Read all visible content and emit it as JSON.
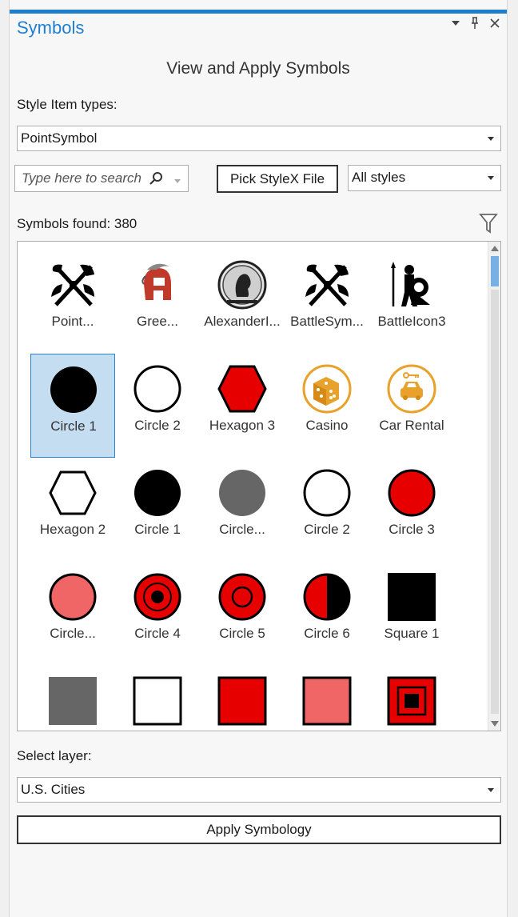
{
  "pane": {
    "title": "Symbols",
    "heading": "View and Apply Symbols"
  },
  "style_types": {
    "label": "Style Item types:",
    "value": "PointSymbol"
  },
  "search": {
    "placeholder": "Type here to search"
  },
  "pick_file_label": "Pick StyleX File",
  "styles_filter": {
    "value": "All styles"
  },
  "results": {
    "count_text": "Symbols found: 380"
  },
  "symbols": [
    {
      "label": "Point...",
      "icon": "battle-axe-icon"
    },
    {
      "label": "Gree...",
      "icon": "greek-helmet-icon"
    },
    {
      "label": "AlexanderI...",
      "icon": "alexander-coin-icon"
    },
    {
      "label": "BattleSym...",
      "icon": "battle-axe-icon"
    },
    {
      "label": "BattleIcon3",
      "icon": "warrior-icon"
    },
    {
      "label": "Circle 1",
      "icon": "circle-black-icon",
      "selected": true
    },
    {
      "label": "Circle 2",
      "icon": "circle-white-icon"
    },
    {
      "label": "Hexagon 3",
      "icon": "hexagon-red-icon"
    },
    {
      "label": "Casino",
      "icon": "casino-dice-icon"
    },
    {
      "label": "Car Rental",
      "icon": "car-rental-icon"
    },
    {
      "label": "Hexagon 2",
      "icon": "hexagon-white-icon"
    },
    {
      "label": "Circle 1",
      "icon": "circle-black-icon"
    },
    {
      "label": "Circle...",
      "icon": "circle-gray-icon"
    },
    {
      "label": "Circle 2",
      "icon": "circle-white-icon"
    },
    {
      "label": "Circle 3",
      "icon": "circle-red-icon"
    },
    {
      "label": "Circle...",
      "icon": "circle-pink-icon"
    },
    {
      "label": "Circle 4",
      "icon": "circle-bullseye-icon"
    },
    {
      "label": "Circle 5",
      "icon": "circle-ring-icon"
    },
    {
      "label": "Circle 6",
      "icon": "circle-half-icon"
    },
    {
      "label": "Square 1",
      "icon": "square-black-icon"
    },
    {
      "label": "",
      "icon": "square-gray-icon"
    },
    {
      "label": "",
      "icon": "square-white-icon"
    },
    {
      "label": "",
      "icon": "square-red-icon"
    },
    {
      "label": "",
      "icon": "square-pink-icon"
    },
    {
      "label": "",
      "icon": "square-nested-icon"
    }
  ],
  "layer": {
    "label": "Select layer:",
    "value": "U.S. Cities"
  },
  "apply_label": "Apply Symbology",
  "colors": {
    "accent": "#1f7fcf",
    "red": "#e60000",
    "pink": "#f06666",
    "gray": "#666666",
    "gold": "#e8a12a",
    "selection": "#c5ddf1"
  }
}
